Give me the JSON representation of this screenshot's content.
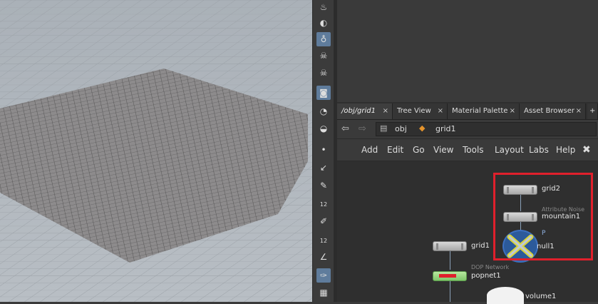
{
  "tabs": [
    {
      "label": "/obj/grid1"
    },
    {
      "label": "Tree View"
    },
    {
      "label": "Material Palette"
    },
    {
      "label": "Asset Browser"
    }
  ],
  "tab_close_glyph": "×",
  "tab_add_glyph": "+",
  "path": {
    "obj": "obj",
    "node": "grid1"
  },
  "menus": [
    "Add",
    "Edit",
    "Go",
    "View",
    "Tools",
    "Layout",
    "Labs",
    "Help"
  ],
  "nodes": {
    "grid2": "grid2",
    "mountain1": "mountain1",
    "mountain1_sub": "Attribute Noise",
    "null1": "null1",
    "grid1": "grid1",
    "popnet1": "popnet1",
    "popnet1_sub": "DOP Network",
    "volume1": "volume1",
    "port_p": "P"
  },
  "shelf_numbers": [
    "12",
    "12"
  ],
  "colors": {
    "highlight_box": "#e0202c",
    "active_tool": "#5f7c9c"
  }
}
